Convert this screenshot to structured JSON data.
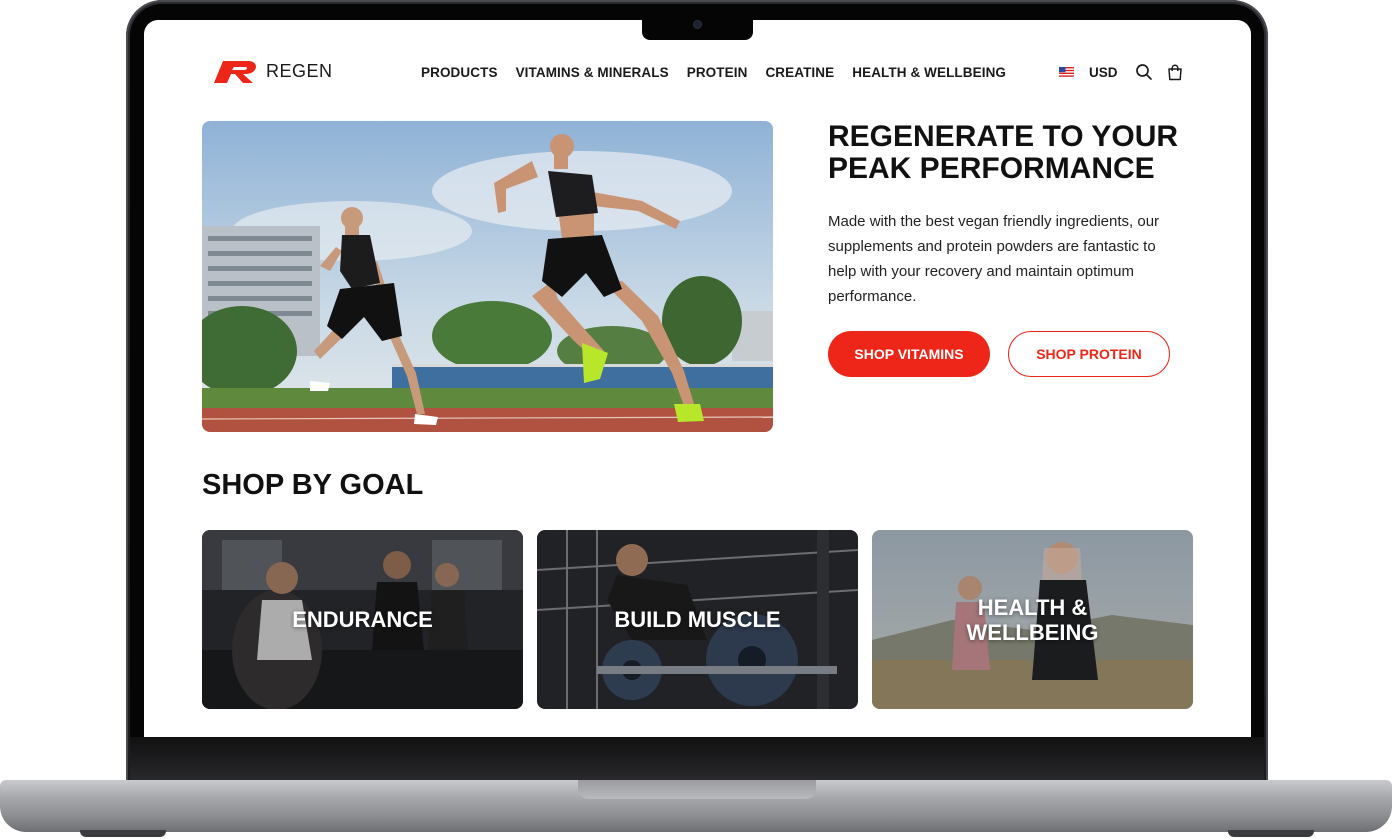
{
  "brand": {
    "name": "REGEN",
    "accent": "#ee2619"
  },
  "nav": {
    "items": [
      "PRODUCTS",
      "VITAMINS & MINERALS",
      "PROTEIN",
      "CREATINE",
      "HEALTH & WELLBEING"
    ]
  },
  "tools": {
    "flag_icon": "us-flag-icon",
    "currency": "USD",
    "search_icon": "search-icon",
    "cart_icon": "cart-icon"
  },
  "hero": {
    "title": "REGENERATE TO YOUR PEAK PERFORMANCE",
    "text": "Made with the best vegan friendly ingredients, our supplements and protein powders are fantastic to help with your recovery and maintain optimum performance.",
    "primary_button": "SHOP VITAMINS",
    "secondary_button": "SHOP PROTEIN"
  },
  "goals": {
    "title": "SHOP BY GOAL",
    "cards": [
      {
        "label": "ENDURANCE"
      },
      {
        "label": "BUILD MUSCLE"
      },
      {
        "label": "HEALTH & WELLBEING"
      }
    ]
  }
}
